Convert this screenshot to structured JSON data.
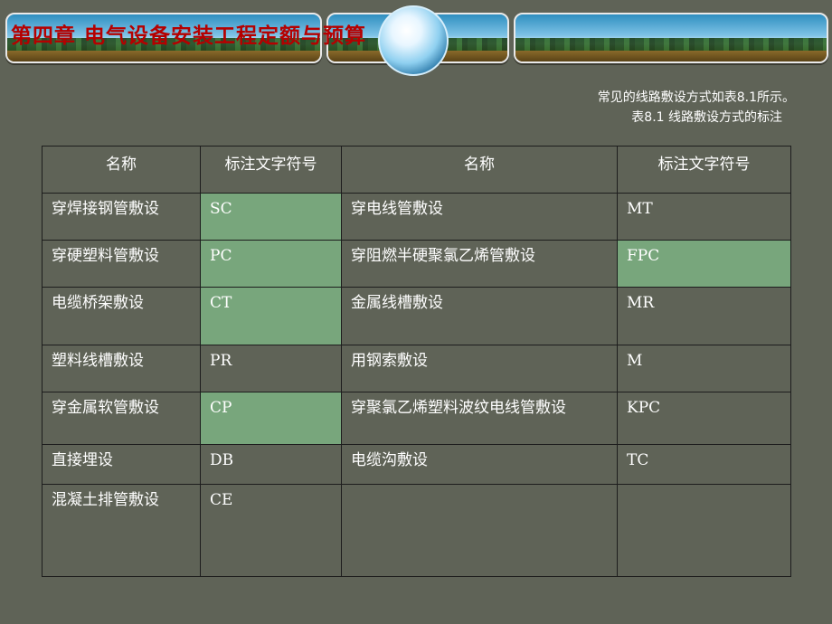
{
  "header": {
    "title": "第四章  电气设备安装工程定额与预算"
  },
  "captions": {
    "line1": "常见的线路敷设方式如表8.1所示。",
    "line2": "表8.1  线路敷设方式的标注"
  },
  "table": {
    "headers": [
      "名称",
      "标注文字符号",
      "名称",
      "标注文字符号"
    ],
    "rows": [
      {
        "name1": "穿焊接钢管敷设",
        "code1": "SC",
        "name2": "穿电线管敷设",
        "code2": "MT"
      },
      {
        "name1": "穿硬塑料管敷设",
        "code1": "PC",
        "name2": "穿阻燃半硬聚氯乙烯管敷设",
        "code2": "FPC"
      },
      {
        "name1": "电缆桥架敷设",
        "code1": "CT",
        "name2": "金属线槽敷设",
        "code2": "MR"
      },
      {
        "name1": "塑料线槽敷设",
        "code1": "PR",
        "name2": "用钢索敷设",
        "code2": "M"
      },
      {
        "name1": "穿金属软管敷设",
        "code1": "CP",
        "name2": "穿聚氯乙烯塑料波纹电线管敷设",
        "code2": "KPC"
      },
      {
        "name1": "直接埋设",
        "code1": "DB",
        "name2": "电缆沟敷设",
        "code2": "TC"
      },
      {
        "name1": "混凝土排管敷设",
        "code1": "CE",
        "name2": "",
        "code2": ""
      }
    ],
    "highlight_color": "#78a67c"
  },
  "colors": {
    "background": "#5f6357",
    "title": "#b50000",
    "text": "#ffffff"
  }
}
